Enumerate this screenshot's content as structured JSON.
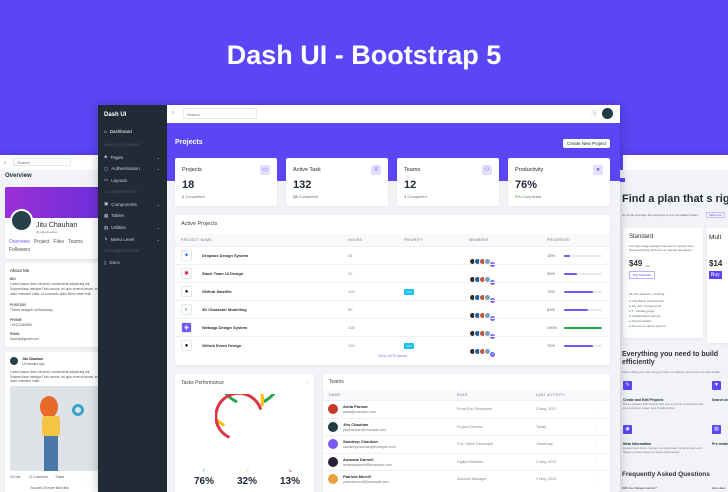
{
  "hero": {
    "title": "Dash UI - Bootstrap 5"
  },
  "main": {
    "brand": "Dash UI",
    "sidebar": [
      {
        "label": "Dashboard",
        "icon": "home-icon"
      },
      {
        "heading": "LAYOUTS & PAGES"
      },
      {
        "label": "Pages",
        "icon": "layers-icon",
        "chevron": true
      },
      {
        "label": "Authentication",
        "icon": "lock-icon",
        "chevron": true
      },
      {
        "label": "Layouts",
        "icon": "layout-icon"
      },
      {
        "heading": "UI COMPONENTS"
      },
      {
        "label": "Components",
        "icon": "package-icon",
        "chevron": true
      },
      {
        "label": "Tables",
        "icon": "table-icon"
      },
      {
        "label": "Utilities",
        "icon": "grid-icon",
        "chevron": true
      },
      {
        "label": "Menu Level",
        "icon": "corner-icon",
        "chevron": true
      },
      {
        "heading": "DOCUMENTATION"
      },
      {
        "label": "Docs",
        "icon": "clipboard-icon"
      }
    ],
    "search_placeholder": "Search",
    "page_title": "Projects",
    "create_button": "Create New Project",
    "stats": [
      {
        "label": "Projects",
        "value": "18",
        "sub_num": "2",
        "sub": "Completed",
        "icon": "briefcase-icon"
      },
      {
        "label": "Active Task",
        "value": "132",
        "sub_num": "28",
        "sub": "Completed",
        "icon": "list-icon"
      },
      {
        "label": "Teams",
        "value": "12",
        "sub_num": "1",
        "sub": "Completed",
        "icon": "users-icon"
      },
      {
        "label": "Productivity",
        "value": "76%",
        "sub_num": "5%",
        "sub": "Completed",
        "icon": "target-icon"
      }
    ],
    "active_projects": {
      "title": "Active Projects",
      "columns": [
        "PROJECT NAME",
        "HOURS",
        "PRIORITY",
        "MEMBERS",
        "PROGRESS"
      ],
      "rows": [
        {
          "name": "Dropbox Design System",
          "hours": "34",
          "priority": "",
          "progress": 15,
          "progress_label": "15%",
          "logo": "dropbox-icon"
        },
        {
          "name": "Slack Team UI Design",
          "hours": "47",
          "priority": "",
          "progress": 35,
          "progress_label": "35%",
          "logo": "slack-icon"
        },
        {
          "name": "GitHub Satellite",
          "hours": "120",
          "priority": "Low",
          "progress": 75,
          "progress_label": "75%",
          "logo": "github-icon"
        },
        {
          "name": "3D Character Modelling",
          "hours": "89",
          "priority": "",
          "progress": 63,
          "progress_label": "63%",
          "logo": "3d-icon"
        },
        {
          "name": "Webapp Design System",
          "hours": "108",
          "priority": "",
          "progress": 100,
          "progress_label": "100%",
          "logo": "layers-icon"
        },
        {
          "name": "Github Event Design",
          "hours": "120",
          "priority": "Low",
          "progress": 75,
          "progress_label": "75%",
          "logo": "github-icon"
        }
      ],
      "members_extra": "+5",
      "view_all": "View All Projects"
    },
    "tasks": {
      "title": "Tasks Performance",
      "values": [
        "76%",
        "32%",
        "13%"
      ],
      "colors": [
        "#22a447",
        "#ffc107",
        "#dc3545"
      ]
    },
    "teams": {
      "title": "Teams",
      "columns": [
        "NAME",
        "ROLE",
        "LAST ACTIVITY"
      ],
      "rows": [
        {
          "name": "Anita Parmar",
          "email": "anita@example.com",
          "role": "Front End Developer",
          "activity": "3 May, 2021"
        },
        {
          "name": "Jitu Chauhan",
          "email": "jituchauhan@example.com",
          "role": "Project Director",
          "activity": "Today"
        },
        {
          "name": "Sandeep Chauhan",
          "email": "sandeepchauhan@example.com",
          "role": "Full- Stack Developer",
          "activity": "Yesterday"
        },
        {
          "name": "Amanda Darnell",
          "email": "amandadarnell@example.com",
          "role": "Digital Marketer",
          "activity": "3 May, 2021"
        },
        {
          "name": "Patricia Murrill",
          "email": "patriciamurrill@example.com",
          "role": "Account Manager",
          "activity": "3 May, 2021"
        }
      ]
    }
  },
  "left": {
    "search_placeholder": "Search",
    "title": "Overview",
    "name": "Jitu Chauhan",
    "handle": "@imjituchauhan",
    "tabs": [
      "Overview",
      "Project",
      "Files",
      "Teams",
      "Followers"
    ],
    "about_title": "About Me",
    "bio_label": "BIO",
    "bio": "Lorem ipsum dolor sit amet, consectetur adipiscing elit. Suspendisse tristique Duis cursus, mi quis viverra ornare, eros dolor interdum nulla, ut commodo diam libero vitae erat.",
    "position_label": "POSITION",
    "position": "Theme designer at Bootstrap.",
    "phone_label": "PHONE",
    "phone": "+32112345689",
    "email_label": "EMAIL",
    "email": "Dashui@gmail.com",
    "post_author": "Jitu Chauhan",
    "post_time": "19 minutes ago",
    "post_text": "Lorem ipsum dolor sit amet, consectetur adipiscing elit. Suspendisse tristique Duis cursus, mi quis viverra ornare, eros dolor interdum nulla.",
    "likes": "20 Like",
    "comments": "12 Comment",
    "share": "Share",
    "liked_by": "You and 20 more liked this"
  },
  "right": {
    "title": "Find a plan that s right",
    "subtitle": "Or simply leverage the expertise of our consultation team.",
    "talk": "Talk to us",
    "plans": [
      {
        "name": "Standard",
        "desc": "For early-stage startups that want to spend more time developing and less on manual operations.",
        "price": "$49",
        "period": "/mo",
        "button": "Buy Standard",
        "features_title": "All core features, including:",
        "features": [
          "Only Basic Components",
          "10+ Adv. Components",
          "5 - Landing page",
          "3 Dashboard Layouts",
          "Documentation",
          "Access to support forums"
        ]
      },
      {
        "name": "Mult",
        "price": "$14",
        "button": "Buy"
      }
    ],
    "section_title": "Everything you need to build efficiently",
    "section_sub": "Start building your app using our tools, be efficient, spend less time with details.",
    "features": [
      {
        "title": "Create and Edit Projects",
        "text": "Donec posuere felis sit amet felis mas imus non consectetur quis leo ut eleifend, sapien quis fringilla finibus.",
        "icon": "edit-icon"
      },
      {
        "title": "Search and",
        "icon": "filter-icon"
      },
      {
        "title": "Meta Information",
        "text": "Aenean justo lorem, semper non lectus quis, porta semper enim. Integer posuere lorem eu neque pellentesque.",
        "icon": "tag-icon"
      },
      {
        "title": "Pre render",
        "icon": "file-icon"
      }
    ],
    "faq_title": "Frequently Asked Questions",
    "faq_q": "Will I be charged now for?",
    "faq_q2": "How does"
  }
}
